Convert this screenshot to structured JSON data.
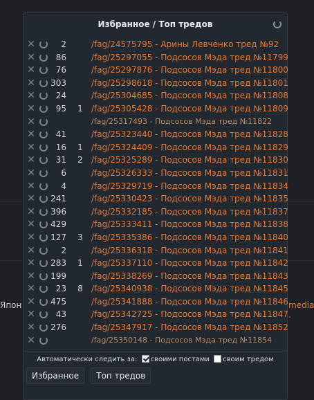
{
  "background": {
    "left_text": "Япон",
    "right_text": "media ."
  },
  "panel": {
    "title": "Избранное / Топ тредов",
    "auto_watch_label": "Автоматически следить за:",
    "own_posts_label": "своими постами",
    "own_posts_checked": true,
    "own_thread_label": "своим тредом",
    "own_thread_checked": false,
    "tabs": [
      "Избранное",
      "Топ тредов"
    ]
  },
  "rows": [
    {
      "count": "2",
      "new": "",
      "link": "/fag/24575795 - Арины Левченко тред №92",
      "dim": false
    },
    {
      "count": "86",
      "new": "",
      "link": "/fag/25297055 - Подсосов Мэда тред №11799",
      "dim": false
    },
    {
      "count": "76",
      "new": "",
      "link": "/fag/25297876 - Подсосов Мэда тред №11800",
      "dim": false
    },
    {
      "count": "303",
      "new": "",
      "link": "/fag/25298618 - Подсосов Мэда тред №11801",
      "dim": false
    },
    {
      "count": "24",
      "new": "",
      "link": "/fag/25304685 - Подсосов Мэда тред №11808",
      "dim": false
    },
    {
      "count": "95",
      "new": "1",
      "link": "/fag/25305428 - Подсосов Мэда тред №11809",
      "dim": false
    },
    {
      "count": "",
      "new": "",
      "link": "/fag/25317493 - Подсосов Мэда тред №11822",
      "dim": true
    },
    {
      "count": "41",
      "new": "",
      "link": "/fag/25323440 - Подсосов Мэда тред №11828",
      "dim": false
    },
    {
      "count": "16",
      "new": "1",
      "link": "/fag/25324409 - Подсосов Мэда тред №11829",
      "dim": false
    },
    {
      "count": "31",
      "new": "2",
      "link": "/fag/25325289 - Подсосов Мэда тред №11830",
      "dim": false
    },
    {
      "count": "6",
      "new": "",
      "link": "/fag/25326333 - Подсосов Мэда тред №11831",
      "dim": false
    },
    {
      "count": "4",
      "new": "",
      "link": "/fag/25329719 - Подсосов Мэда тред №11834",
      "dim": false
    },
    {
      "count": "241",
      "new": "",
      "link": "/fag/25330423 - Подсосов Мэда тред №11835",
      "dim": false
    },
    {
      "count": "396",
      "new": "",
      "link": "/fag/25332185 - Подсосов Мэда тред №11837",
      "dim": false
    },
    {
      "count": "429",
      "new": "",
      "link": "/fag/25333411 - Подсосов Мэда тред №11838",
      "dim": false
    },
    {
      "count": "127",
      "new": "3",
      "link": "/fag/25335386 - Подсосов Мэда тред №11840",
      "dim": false
    },
    {
      "count": "2",
      "new": "",
      "link": "/fag/25336318 - Подсосов Мэда тред №11841",
      "dim": false
    },
    {
      "count": "283",
      "new": "1",
      "link": "/fag/25337110 - Подсосов Мэда тред №11842",
      "dim": false
    },
    {
      "count": "199",
      "new": "",
      "link": "/fag/25338269 - Подсосов Мэда тред №11843",
      "dim": false
    },
    {
      "count": "23",
      "new": "8",
      "link": "/fag/25340938 - Подсосов Мэда тред №11845",
      "dim": false
    },
    {
      "count": "475",
      "new": "",
      "link": "/fag/25341888 - Подсосов Мэда тред №11846",
      "dim": false
    },
    {
      "count": "43",
      "new": "",
      "link": "/fag/25342725 - Подсосов Мэда тред №11847",
      "dim": false
    },
    {
      "count": "276",
      "new": "",
      "link": "/fag/25347917 - Подсосов Мэда тред №11852",
      "dim": false
    },
    {
      "count": "",
      "new": "",
      "link": "/fag/25350148 - Подсосов Мэда тред №11854",
      "dim": true
    }
  ],
  "colors": {
    "link": "#e97a2f",
    "link_dim": "#b98a63",
    "panel_bg": "#222830",
    "page_bg": "#1d2125"
  },
  "icons": {
    "remove": "close-icon",
    "refresh": "refresh-icon"
  }
}
